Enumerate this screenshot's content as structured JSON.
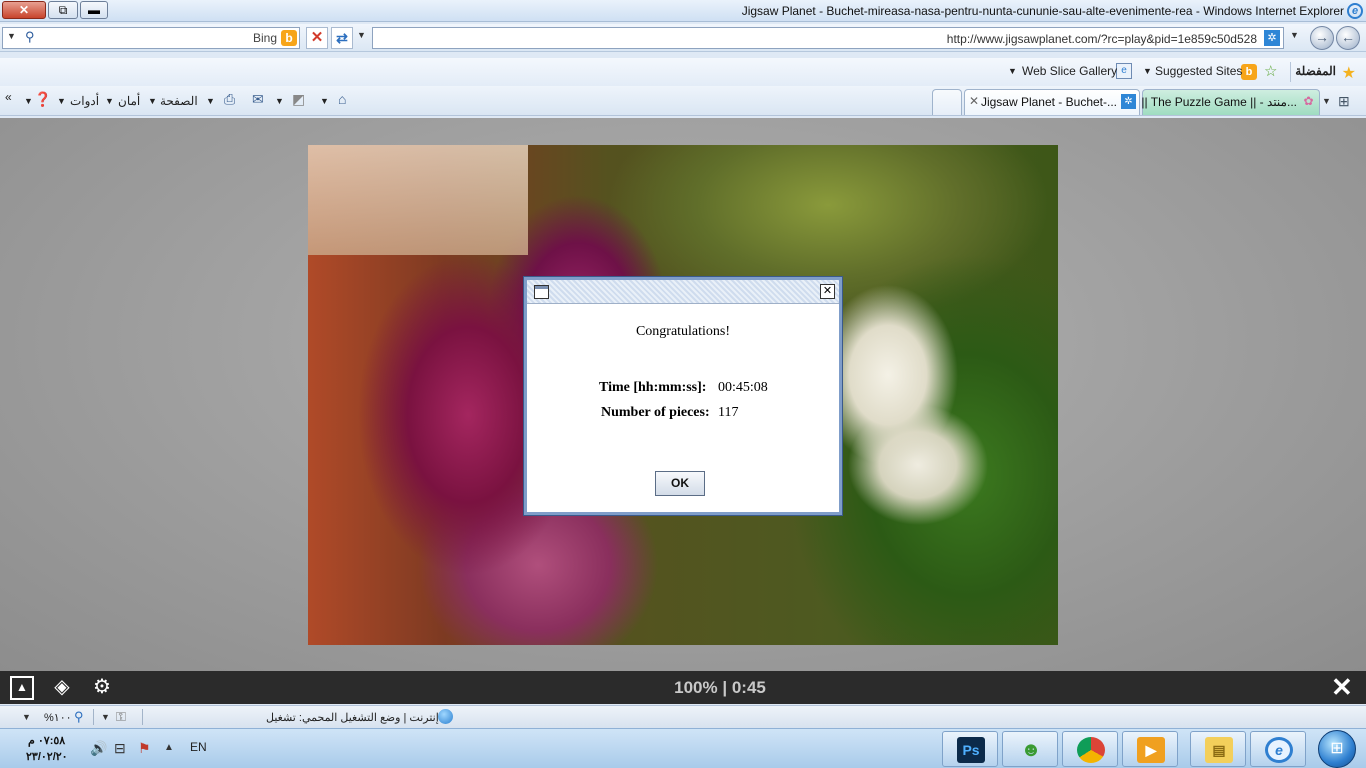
{
  "window": {
    "title": "Jigsaw Planet - Buchet-mireasa-nasa-pentru-nunta-cununie-sau-alte-evenimente-rea - Windows Internet Explorer",
    "close_icon": "✕",
    "restore_icon": "⧉",
    "minimize_icon": "▬"
  },
  "search": {
    "value": "",
    "provider": "Bing"
  },
  "address": {
    "url": "http://www.jigsawplanet.com/?rc=play&pid=1e859c50d528"
  },
  "favorites": {
    "label": "المفضلة",
    "suggested_sites": "Suggested Sites",
    "web_slice_gallery": "Web Slice Gallery"
  },
  "commandbar": {
    "tools": "أدوات",
    "safety": "أمان",
    "page": "الصفحة"
  },
  "tabs": [
    {
      "label": "Jigsaw Planet - Buchet-...",
      "active": true
    },
    {
      "label": "|| The Puzzle Game || - منتد...",
      "active": false
    }
  ],
  "dialog": {
    "message": "Congratulations!",
    "time_label": "Time [hh:mm:ss]:",
    "time_value": "00:45:08",
    "pieces_label": "Number of pieces:",
    "pieces_value": "117",
    "ok_label": "OK"
  },
  "puzzle_bar": {
    "status": "100% | 0:45"
  },
  "statusbar": {
    "zoom": "%١٠٠",
    "zone": "إنترنت | وضع التشغيل المحمي: تشغيل"
  },
  "taskbar": {
    "time": "٠٧:٥٨ م",
    "date": "٢٣/٠٢/٢٠",
    "language": "EN"
  },
  "colors": {
    "puzzle_bar_bg": "#2b2b2b",
    "dialog_border": "#7f9dc9",
    "status_text": "#c9c9c9"
  }
}
